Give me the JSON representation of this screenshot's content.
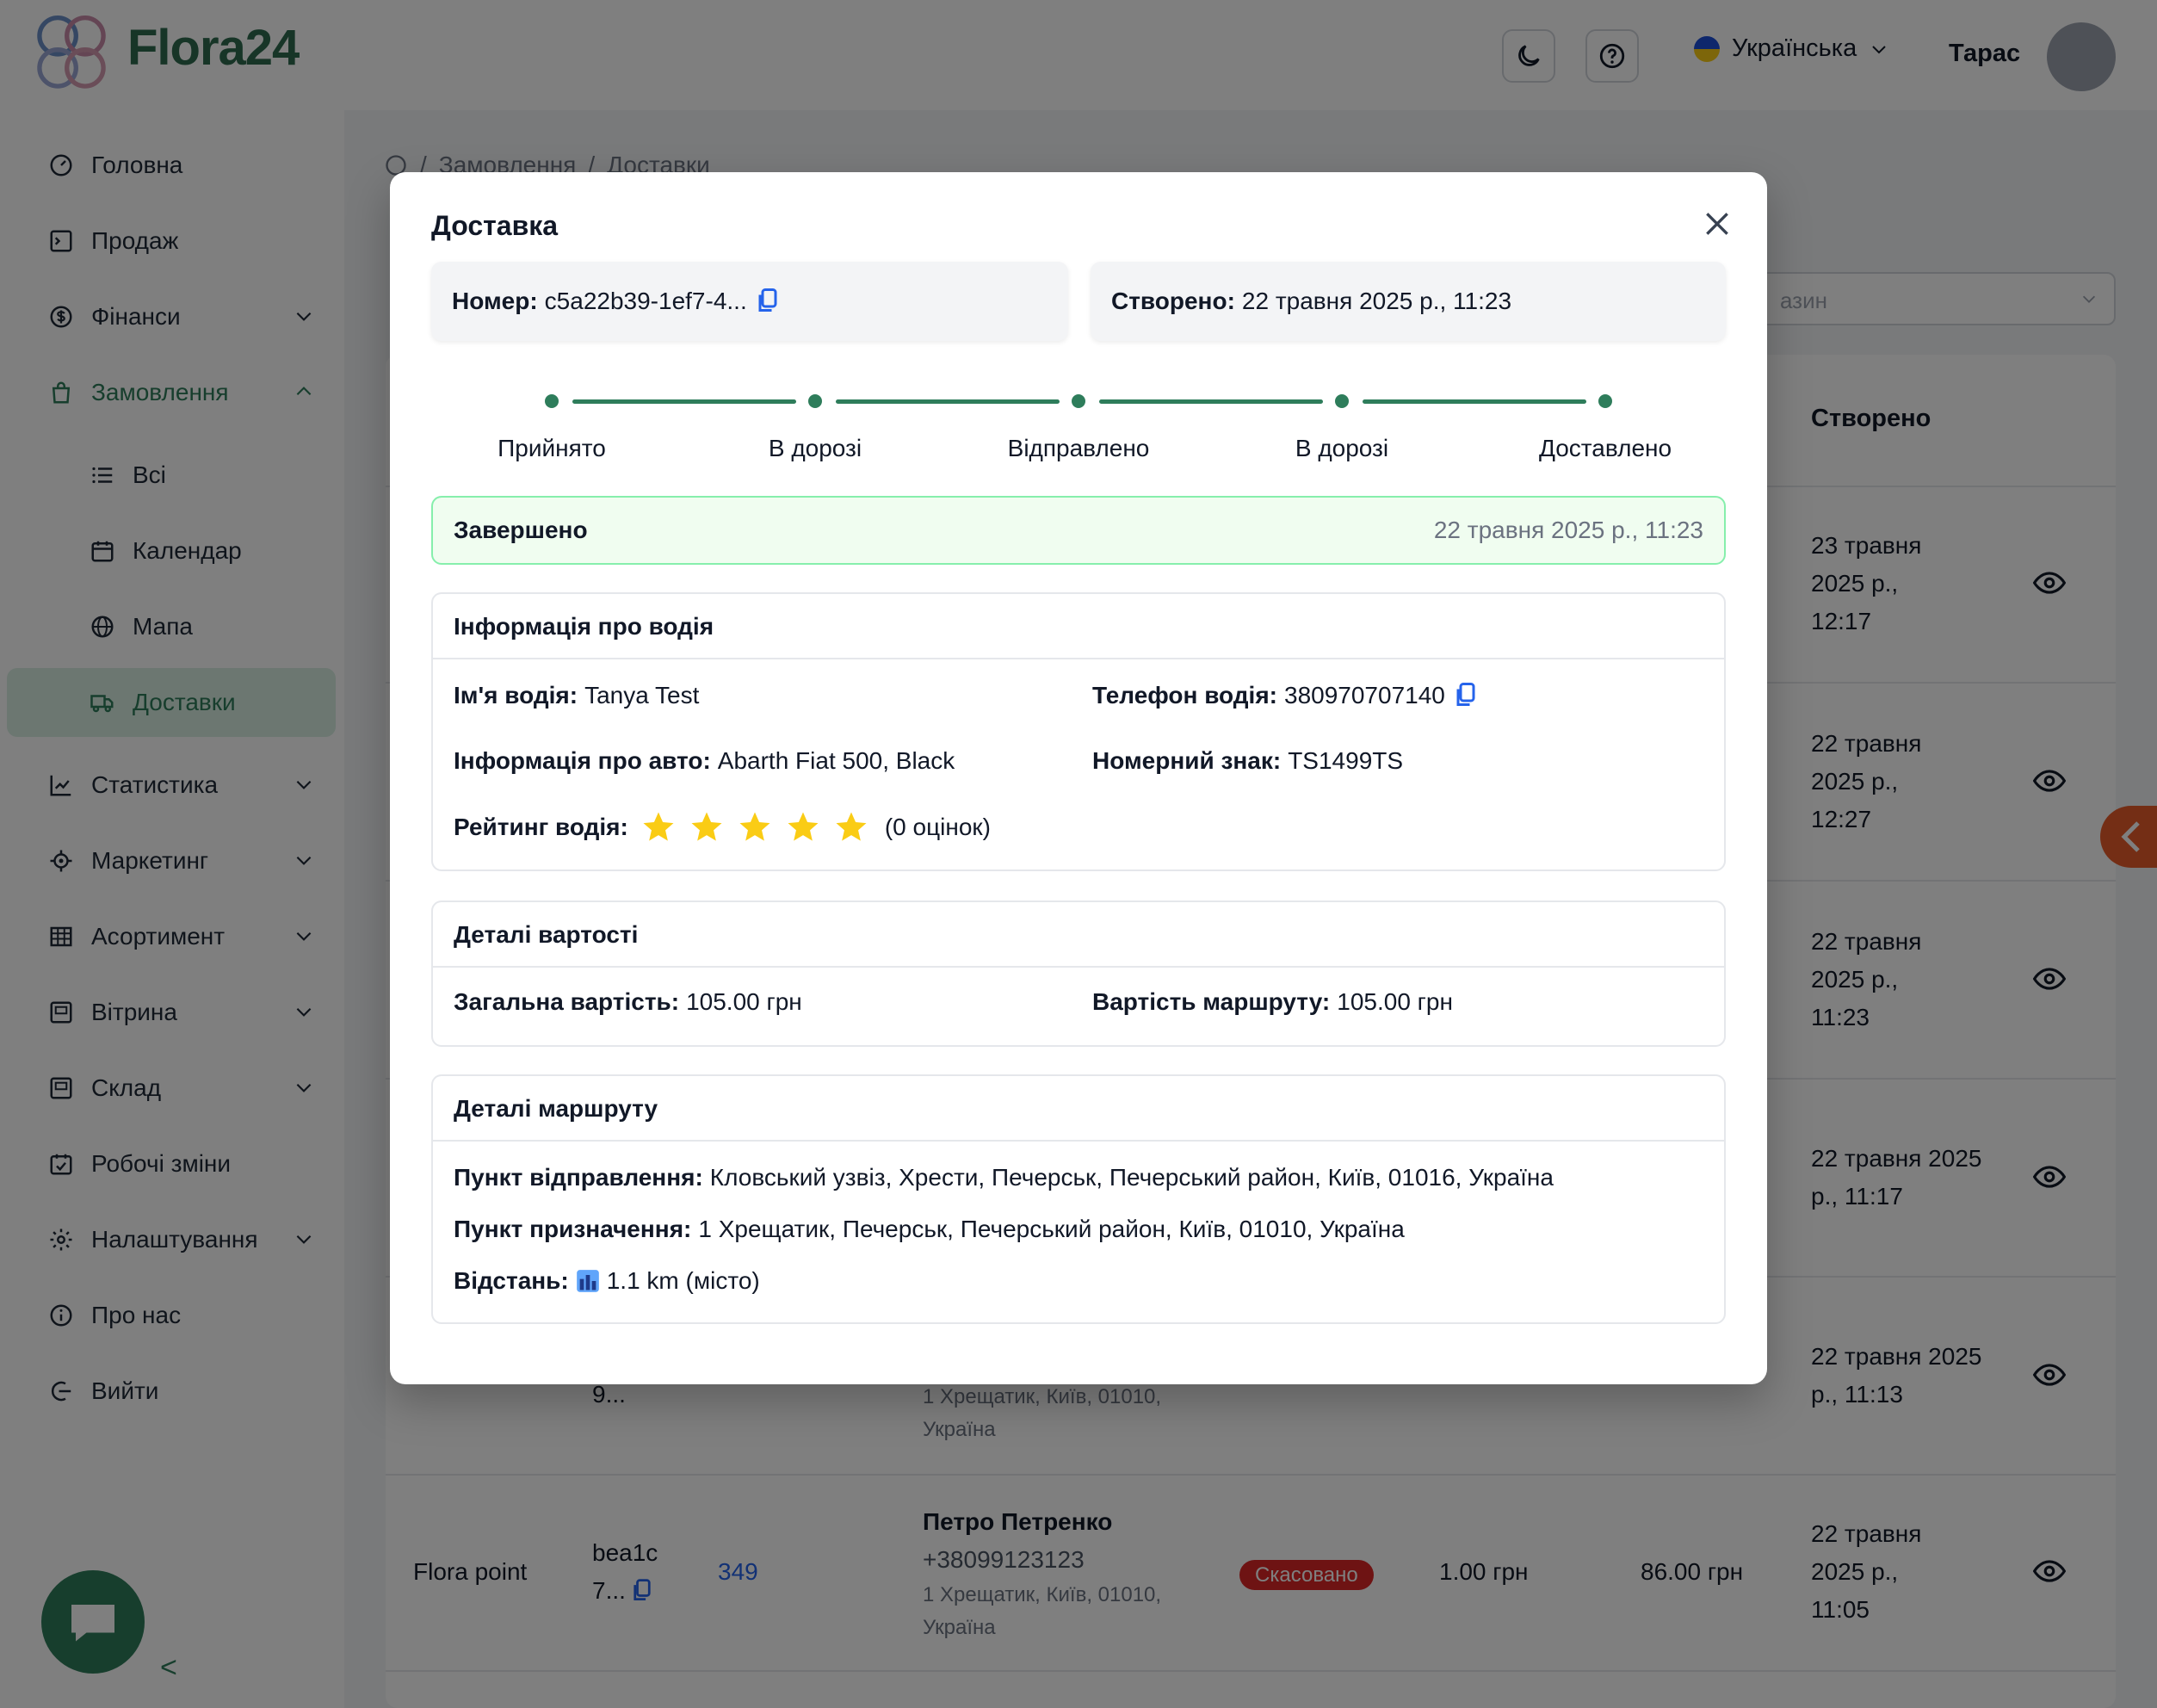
{
  "app": {
    "brand": "Flora24",
    "language": "Українська",
    "user_name": "Тарас"
  },
  "sidebar": {
    "items": [
      {
        "label": "Головна"
      },
      {
        "label": "Продаж"
      },
      {
        "label": "Фінанси"
      },
      {
        "label": "Замовлення"
      },
      {
        "label": "Всі"
      },
      {
        "label": "Календар"
      },
      {
        "label": "Мапа"
      },
      {
        "label": "Доставки"
      },
      {
        "label": "Статистика"
      },
      {
        "label": "Маркетинг"
      },
      {
        "label": "Асортимент"
      },
      {
        "label": "Вітрина"
      },
      {
        "label": "Склад"
      },
      {
        "label": "Робочі зміни"
      },
      {
        "label": "Налаштування"
      },
      {
        "label": "Про нас"
      },
      {
        "label": "Вийти"
      }
    ],
    "collapse_glyph": "<"
  },
  "background": {
    "breadcrumbs": [
      "/",
      "Замовлення",
      "/",
      "Доставки"
    ],
    "filter_placeholder": "азин",
    "table_header_created": "Створено",
    "created_dates": [
      "23 травня 2025 р., 12:17",
      "22 травня 2025 р., 12:27",
      "22 травня 2025 р., 11:23",
      "22 травня 2025 р., 11:17",
      "22 травня 2025 р., 11:13",
      "22 травня 2025 р., 11:05"
    ],
    "partial_row": {
      "id_tail": "9...",
      "address_1": "1 Хрещатик, Київ, 01010,",
      "address_2": "Україна"
    },
    "last_row": {
      "shop": "Flora point",
      "id_1": "bea1c",
      "id_2": "7...",
      "order_no": "349",
      "customer": "Петро Петренко",
      "phone": "+38099123123",
      "address_1": "1 Хрещатик, Київ, 01010,",
      "address_2": "Україна",
      "status": "Скасовано",
      "amount_1": "1.00 грн",
      "amount_2": "86.00 грн"
    }
  },
  "modal": {
    "title": "Доставка",
    "number_label": "Номер:",
    "number_value": "c5a22b39-1ef7-4...",
    "created_label": "Створено:",
    "created_value": "22 травня 2025 р., 11:23",
    "steps": [
      "Прийнято",
      "В дорозі",
      "Відправлено",
      "В дорозі",
      "Доставлено"
    ],
    "status": {
      "label": "Завершено",
      "date": "22 травня 2025 р., 11:23"
    },
    "driver": {
      "title": "Інформація про водія",
      "name_label": "Ім'я водія:",
      "name_value": "Tanya Test",
      "phone_label": "Телефон водія:",
      "phone_value": "380970707140",
      "car_label": "Інформація про авто:",
      "car_value": "Abarth Fiat 500, Black",
      "plate_label": "Номерний знак:",
      "plate_value": "TS1499TS",
      "rating_label": "Рейтинг водія:",
      "rating_stars": 5,
      "rating_count": "(0 оцінок)"
    },
    "cost": {
      "title": "Деталі вартості",
      "total_label": "Загальна вартість:",
      "total_value": "105.00 грн",
      "route_label": "Вартість маршруту:",
      "route_value": "105.00 грн"
    },
    "route": {
      "title": "Деталі маршруту",
      "from_label": "Пункт відправлення:",
      "from_value": "Кловський узвіз, Хрести, Печерськ, Печерський район, Київ, 01016, Україна",
      "to_label": "Пункт призначення:",
      "to_value": "1 Хрещатик, Печерськ, Печерський район, Київ, 01010, Україна",
      "distance_label": "Відстань:",
      "distance_value": "1.1 km (місто)"
    }
  },
  "colors": {
    "brand_green": "#2e7d5b",
    "status_bg": "#f0fdf0",
    "star": "#facc15",
    "copy_icon": "#2563eb",
    "cancel_red": "#dc2626"
  }
}
